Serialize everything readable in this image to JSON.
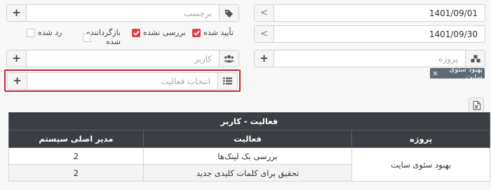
{
  "right_panel": {
    "date_from": "1401/09/01",
    "date_to": "1401/09/30",
    "project_placeholder": "پروژه",
    "selected_project_tag": "بهبود سئوی سایت",
    "tag_remove": "×"
  },
  "left_panel": {
    "tag_placeholder": "برچسب",
    "status_options": [
      {
        "label": "تأیید شده",
        "checked": true
      },
      {
        "label": "بررسی نشده",
        "checked": true
      },
      {
        "label": "بازگرداننده شده",
        "checked": false
      },
      {
        "label": "رد شده",
        "checked": false
      }
    ],
    "user_placeholder": "کاربر",
    "activity_placeholder": "انتخاب فعالیت"
  },
  "table": {
    "title": "فعالیت - کاربر",
    "columns": [
      "پروژه",
      "فعالیت",
      "مدیر اصلی سیستم"
    ],
    "rows": [
      {
        "project": "بهبود سئوی سایت",
        "activity": "بررسی بک لینک‌ها",
        "value": "2"
      },
      {
        "activity": "تحقیق برای کلمات کلیدی جدید",
        "value": "2"
      }
    ]
  },
  "icons": {
    "tag": "tag-icon",
    "users": "users-icon",
    "list": "list-icon",
    "project": "cubes-icon",
    "export": "file-excel-icon"
  },
  "colors": {
    "checked": "#d9414b",
    "highlight": "#c9262d",
    "table_header": "#3b3f44",
    "chip": "#5f6a74"
  }
}
